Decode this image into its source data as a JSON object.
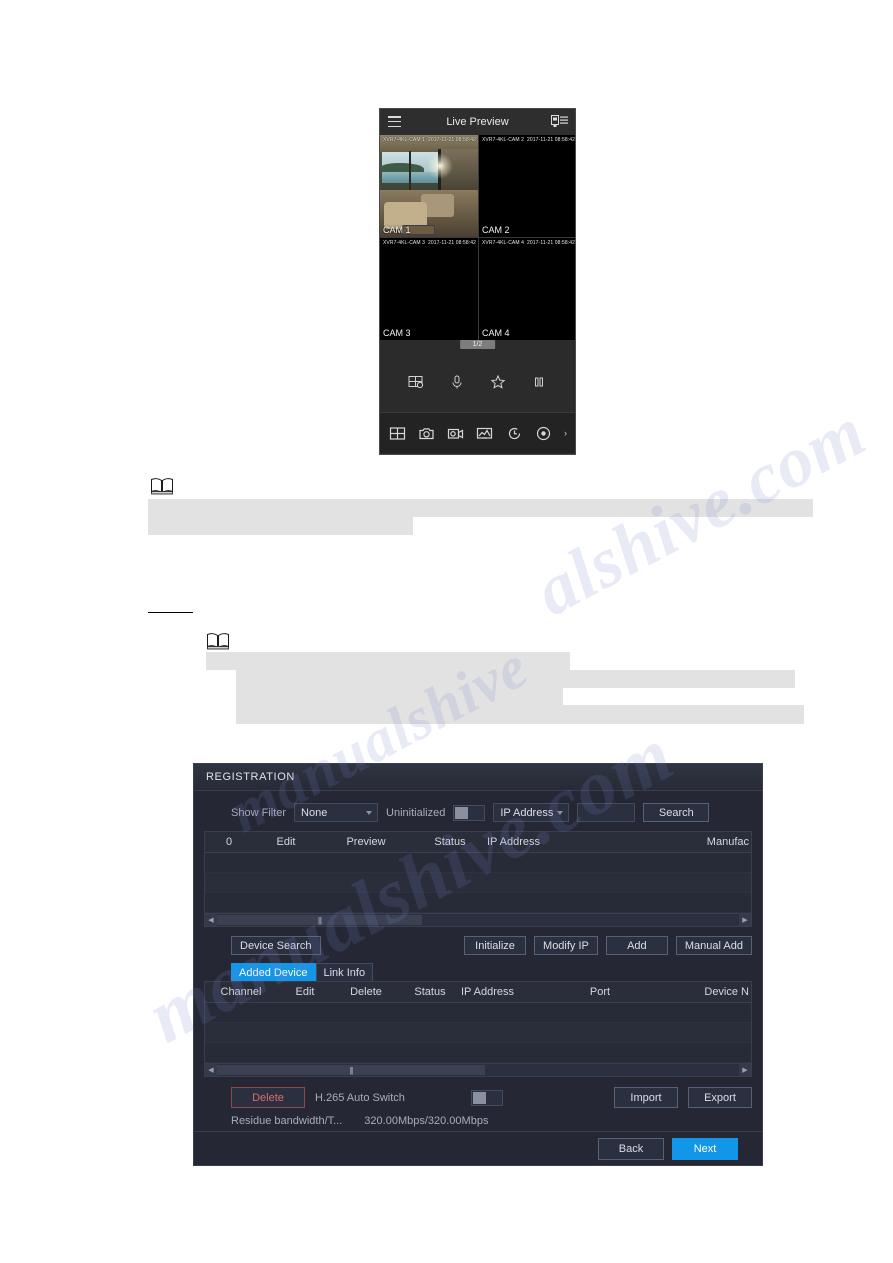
{
  "watermark": {
    "line_a": "alshive.com",
    "line_b": "manualshive.com",
    "line_c": "manualshive"
  },
  "phone_app": {
    "title": "Live Preview",
    "menu_icon": "hamburger-icon",
    "device_list_icon": "device-list-icon",
    "page_indicator": "1/2",
    "channels": [
      {
        "osd_name": "XVR7-4KL-CAM 1",
        "osd_time": "2017-11-21 08:58:42",
        "label": "CAM 1"
      },
      {
        "osd_name": "XVR7-4KL-CAM 2",
        "osd_time": "2017-11-21 08:58:42",
        "label": "CAM 2"
      },
      {
        "osd_name": "XVR7-4KL-CAM 3",
        "osd_time": "2017-11-21 08:58:42",
        "label": "CAM 3"
      },
      {
        "osd_name": "XVR7-4KL-CAM 4",
        "osd_time": "2017-11-21 08:58:42",
        "label": "CAM 4"
      }
    ],
    "toolbar_primary": [
      "split-screen-icon",
      "microphone-icon",
      "favorite-star-icon",
      "pause-icon"
    ],
    "toolbar_secondary": [
      "grid-view-icon",
      "snapshot-camera-icon",
      "record-video-icon",
      "image-playback-icon",
      "history-clock-icon",
      "ptz-target-icon"
    ],
    "toolbar_more": "›"
  },
  "notes": {
    "note1_icon": "book-note-icon",
    "note2_icon": "book-note-icon"
  },
  "dialog": {
    "title": "REGISTRATION",
    "filter": {
      "show_filter_label": "Show Filter",
      "filter_value": "None",
      "filter_options": [
        "None"
      ],
      "uninitialized_label": "Uninitialized",
      "uninitialized_on": false,
      "search_type_value": "IP Address",
      "search_type_options": [
        "IP Address"
      ],
      "search_input_value": "",
      "search_button": "Search"
    },
    "search_table": {
      "columns": [
        "0",
        "Edit",
        "Preview",
        "Status",
        "IP Address",
        "Manufac"
      ],
      "rows": []
    },
    "device_search_label": "Device Search",
    "action_buttons": [
      "Initialize",
      "Modify IP",
      "Add",
      "Manual Add"
    ],
    "tabs": [
      {
        "label": "Added Device",
        "active": true
      },
      {
        "label": "Link Info",
        "active": false
      }
    ],
    "added_table": {
      "columns": [
        "Channel",
        "Edit",
        "Delete",
        "Status",
        "IP Address",
        "Port",
        "Device N"
      ],
      "rows": []
    },
    "bottom": {
      "delete_button": "Delete",
      "h265_label": "H.265 Auto Switch",
      "h265_on": false,
      "import_button": "Import",
      "export_button": "Export",
      "residue_label": "Residue bandwidth/T...",
      "residue_value": "320.00Mbps/320.00Mbps"
    },
    "footer": {
      "back_button": "Back",
      "next_button": "Next"
    },
    "colors": {
      "accent": "#1296e8",
      "danger": "#e06a6a",
      "panel": "#252834"
    }
  }
}
